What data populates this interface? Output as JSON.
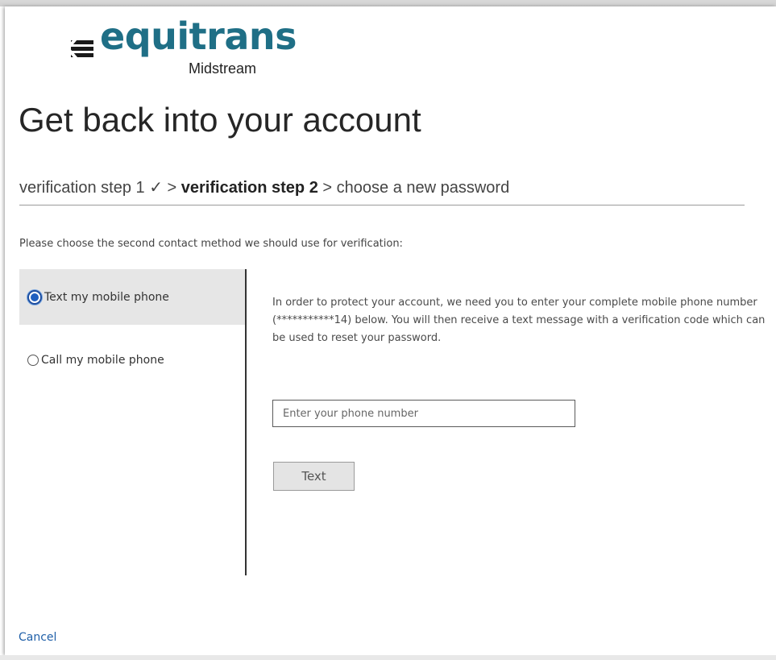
{
  "brand": {
    "logo_mark_icon": "e-arrow-logo-icon",
    "name": "equitrans",
    "subtitle": "Midstream",
    "color": "#1f6f86"
  },
  "page": {
    "title": "Get back into your account"
  },
  "steps": {
    "step1": "verification step 1 ✓",
    "sep1": ">",
    "step2": "verification step 2",
    "sep2": ">",
    "step3": "choose a new password"
  },
  "instruction": "Please choose the second contact method we should use for verification:",
  "methods": [
    {
      "label": "Text my mobile phone",
      "selected": true
    },
    {
      "label": "Call my mobile phone",
      "selected": false
    }
  ],
  "detail": {
    "text": "In order to protect your account, we need you to enter your complete mobile phone number (***********14) below. You will then receive a text message with a verification code which can be used to reset your password.",
    "phone_placeholder": "Enter your phone number",
    "phone_value": "",
    "submit_label": "Text"
  },
  "footer": {
    "cancel_label": "Cancel"
  },
  "colors": {
    "accent": "#1f5fbf",
    "link": "#1f5fa8",
    "selected_bg": "#e6e6e6"
  }
}
